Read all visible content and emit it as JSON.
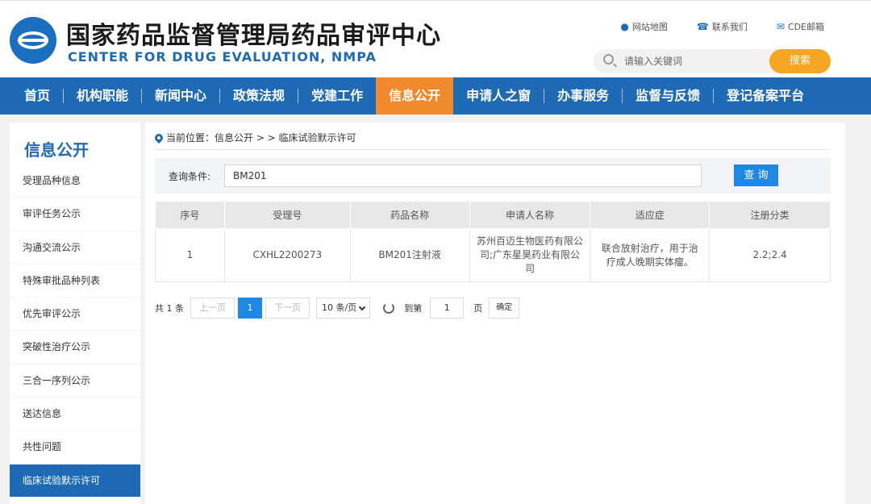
{
  "header": {
    "title_cn": "国家药品监督管理局药品审评中心",
    "title_en": "CENTER FOR DRUG EVALUATION, NMPA",
    "links": [
      {
        "label": "网站地图",
        "icon": "map-pin-icon"
      },
      {
        "label": "联系我们",
        "icon": "phone-icon"
      },
      {
        "label": "CDE邮箱",
        "icon": "mail-icon"
      }
    ],
    "search_placeholder": "请输入关键词",
    "search_button": "搜索"
  },
  "nav": {
    "items": [
      "首页",
      "机构职能",
      "新闻中心",
      "政策法规",
      "党建工作",
      "信息公开",
      "申请人之窗",
      "办事服务",
      "监督与反馈",
      "登记备案平台"
    ],
    "active": "信息公开"
  },
  "sidebar": {
    "title": "信息公开",
    "items": [
      "受理品种信息",
      "审评任务公示",
      "沟通交流公示",
      "特殊审批品种列表",
      "优先审评公示",
      "突破性治疗公示",
      "三合一序列公示",
      "送达信息",
      "共性问题",
      "临床试验默示许可"
    ],
    "active": "临床试验默示许可"
  },
  "breadcrumb": "当前位置：信息公开 > > 临床试验默示许可",
  "query": {
    "label": "查询条件:",
    "value": "BM201",
    "button": "查 询"
  },
  "table": {
    "headers": [
      "序号",
      "受理号",
      "药品名称",
      "申请人名称",
      "适应症",
      "注册分类"
    ],
    "rows": [
      [
        "1",
        "CXHL2200273",
        "BM201注射液",
        "苏州百迈生物医药有限公司;广东星昊药业有限公司",
        "联合放射治疗，用于治疗成人晚期实体瘤。",
        "2.2;2.4"
      ]
    ]
  },
  "pager": {
    "total": "共 1 条",
    "prev": "上一页",
    "current": "1",
    "next": "下一页",
    "page_size": "10 条/页",
    "goto_label": "到第",
    "goto_value": "1",
    "page_unit": "页",
    "confirm": "确定"
  }
}
